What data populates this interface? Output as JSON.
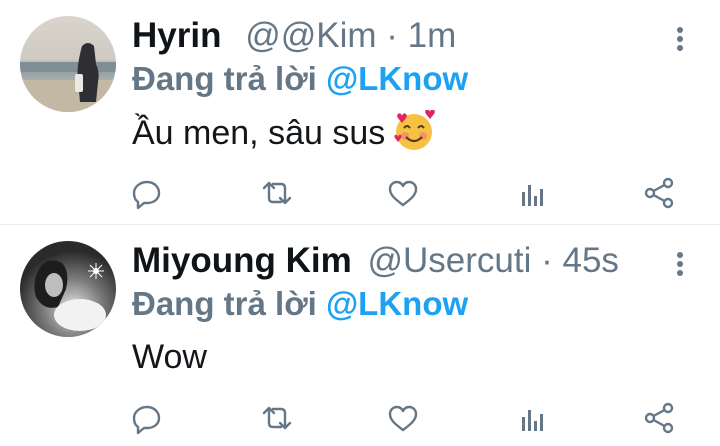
{
  "tweets": [
    {
      "display_name": "Hyrin",
      "handle": "@@Kim",
      "separator": "·",
      "time": "1m",
      "reply_prefix": "Đang trả lời",
      "reply_to": "@LKnow",
      "text": "Ầu men, sâu sus",
      "emoji": "smiling-face-with-hearts-emoji",
      "avatar": "beach-photo-avatar"
    },
    {
      "display_name": "Miyoung Kim",
      "handle": "@Usercuti",
      "separator": "·",
      "time": "45s",
      "reply_prefix": "Đang trả lời",
      "reply_to": "@LKnow",
      "text": "Wow",
      "avatar": "sparkler-photo-avatar"
    }
  ],
  "action_icons": [
    "reply-icon",
    "retweet-icon",
    "like-icon",
    "analytics-icon",
    "share-icon"
  ],
  "more_icon": "more-vertical-icon",
  "colors": {
    "name": "#0f1419",
    "secondary": "#657786",
    "mention": "#1da1f2",
    "divider": "#e6ecf0"
  }
}
